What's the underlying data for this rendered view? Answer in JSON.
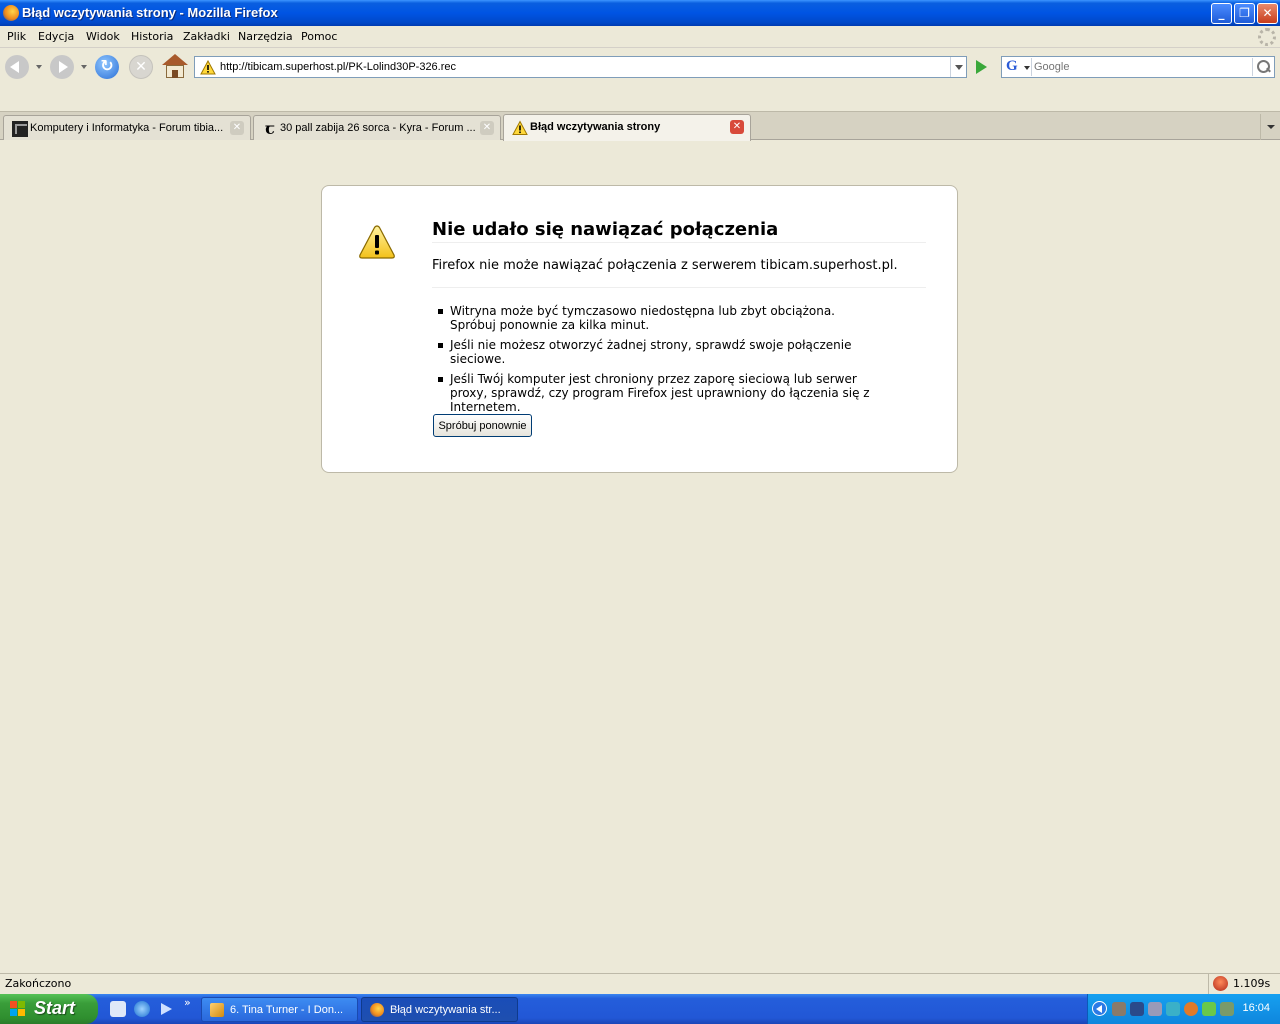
{
  "window": {
    "title": "Błąd wczytywania strony - Mozilla Firefox",
    "controls": [
      "minimize",
      "restore",
      "close"
    ]
  },
  "menubar": {
    "items": [
      "Plik",
      "Edycja",
      "Widok",
      "Historia",
      "Zakładki",
      "Narzędzia",
      "Pomoc"
    ]
  },
  "navbar": {
    "url": "http://tibicam.superhost.pl/PK-Lolind30P-326.rec",
    "search_placeholder": "Google",
    "search_engine_letter": "G"
  },
  "tabs": [
    {
      "label": "Komputery i Informatyka - Forum tibia...",
      "icon": "forum-favicon",
      "active": false
    },
    {
      "label": "30 pall zabija 26 sorca - Kyra - Forum ...",
      "icon": "tibia-t-favicon",
      "active": false
    },
    {
      "label": "Błąd wczytywania strony",
      "icon": "warning-icon",
      "active": true
    }
  ],
  "error_page": {
    "title": "Nie udało się nawiązać połączenia",
    "description": "Firefox nie może nawiązać połączenia z serwerem tibicam.superhost.pl.",
    "items": [
      "Witryna może być tymczasowo niedostępna lub zbyt obciążona. Spróbuj ponownie za kilka minut.",
      "Jeśli nie możesz otworzyć żadnej strony, sprawdź swoje połączenie sieciowe.",
      "Jeśli Twój komputer jest chroniony przez zaporę sieciową lub serwer proxy, sprawdź, czy program Firefox jest uprawniony do łączenia się z Internetem."
    ],
    "retry_label": "Spróbuj ponownie"
  },
  "statusbar": {
    "text": "Zakończono",
    "timing": "1.109s"
  },
  "taskbar": {
    "start_label": "Start",
    "quicklaunch_chevron": "»",
    "tasks": [
      {
        "label": "6. Tina Turner - I Don...",
        "icon": "media-player-icon"
      },
      {
        "label": "Błąd wczytywania str...",
        "icon": "firefox-icon"
      }
    ],
    "clock": "16:04"
  },
  "colors": {
    "titlebar": "#0054e3",
    "content_bg": "#ece9d8",
    "error_box_bg": "#ffffff",
    "active_tab_close": "#d84a3a",
    "start_button": "#3a9e3a"
  }
}
